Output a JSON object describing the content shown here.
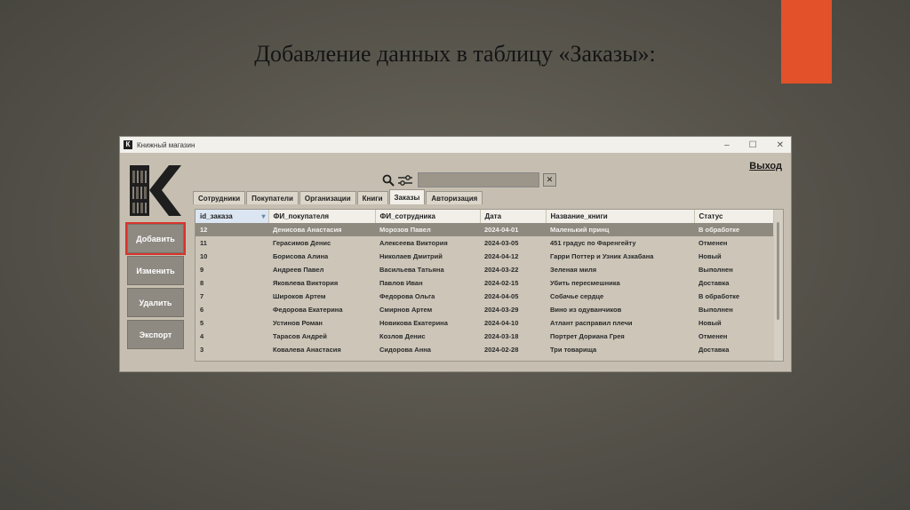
{
  "slide": {
    "title": "Добавление данных в таблицу «Заказы»:",
    "accent_color": "#e2512a"
  },
  "window": {
    "title": "Книжный магазин",
    "app_icon": "К",
    "controls": {
      "minimize": "–",
      "maximize": "☐",
      "close": "✕"
    },
    "exit_label": "Выход"
  },
  "search": {
    "icon": "search-icon",
    "filter_icon": "filter-sliders-icon",
    "value": "",
    "clear_label": "✕"
  },
  "tabs": [
    "Сотрудники",
    "Покупатели",
    "Организации",
    "Книги",
    "Заказы",
    "Авторизация"
  ],
  "active_tab": "Заказы",
  "side_buttons": {
    "add": "Добавить",
    "edit": "Изменить",
    "delete": "Удалить",
    "export": "Экспорт"
  },
  "table": {
    "columns": [
      "id_заказа",
      "ФИ_покупателя",
      "ФИ_сотрудника",
      "Дата",
      "Название_книги",
      "Статус"
    ],
    "rows": [
      [
        "12",
        "Денисова Анастасия",
        "Морозов Павел",
        "2024-04-01",
        "Маленький принц",
        "В обработке"
      ],
      [
        "11",
        "Герасимов Денис",
        "Алексеева Виктория",
        "2024-03-05",
        "451 градус по Фаренгейту",
        "Отменен"
      ],
      [
        "10",
        "Борисова Алина",
        "Николаев Дмитрий",
        "2024-04-12",
        "Гарри Поттер и Узник Азкабана",
        "Новый"
      ],
      [
        "9",
        "Андреев Павел",
        "Васильева Татьяна",
        "2024-03-22",
        "Зеленая миля",
        "Выполнен"
      ],
      [
        "8",
        "Яковлева Виктория",
        "Павлов Иван",
        "2024-02-15",
        "Убить пересмешника",
        "Доставка"
      ],
      [
        "7",
        "Широков Артем",
        "Федорова Ольга",
        "2024-04-05",
        "Собачье сердце",
        "В обработке"
      ],
      [
        "6",
        "Федорова Екатерина",
        "Смирнов Артем",
        "2024-03-29",
        "Вино из одуванчиков",
        "Выполнен"
      ],
      [
        "5",
        "Устинов Роман",
        "Новикова Екатерина",
        "2024-04-10",
        "Атлант расправил плечи",
        "Новый"
      ],
      [
        "4",
        "Тарасов Андрей",
        "Козлов Денис",
        "2024-03-18",
        "Портрет Дориана Грея",
        "Отменен"
      ],
      [
        "3",
        "Ковалева Анастасия",
        "Сидорова Анна",
        "2024-02-28",
        "Три товарища",
        "Доставка"
      ]
    ],
    "selected_row": 0,
    "sorted_column": "id_заказа"
  }
}
